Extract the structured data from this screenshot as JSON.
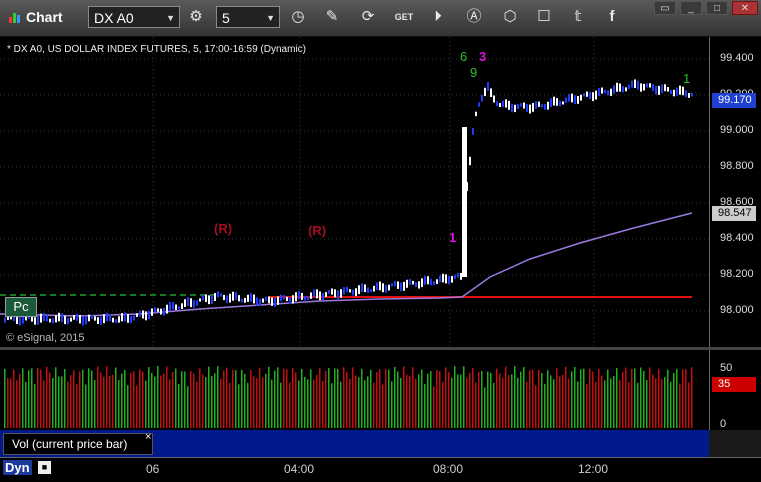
{
  "app": {
    "title": "Chart"
  },
  "toolbar": {
    "symbol": "DX A0",
    "interval": "5",
    "icons": [
      "settings-icon",
      "clock-icon",
      "pencil-icon",
      "refresh-icon",
      "get-icon",
      "play-icon",
      "a-icon",
      "tag-icon",
      "comment-icon",
      "twitter-icon",
      "facebook-icon"
    ]
  },
  "window_buttons": [
    "restore",
    "min",
    "max",
    "close"
  ],
  "chart": {
    "description": "* DX A0, US DOLLAR INDEX FUTURES, 5, 17:00-16:59 (Dynamic)",
    "copyright": "© eSignal, 2015",
    "pc_label": "Pc",
    "price_labels": [
      "99.400",
      "99.200",
      "99.000",
      "98.800",
      "98.600",
      "98.400",
      "98.200",
      "98.000"
    ],
    "last_price": "99.170",
    "ma_value": "98.547",
    "annotations": {
      "r1": "(R)",
      "r2": "(R)",
      "n1": "1",
      "n6": "6",
      "n3": "3",
      "n9": "9",
      "n1b": "1"
    },
    "colors": {
      "price_up": "#ffffff",
      "price_down": "#1f3cff",
      "ma": "#9a7ae0",
      "support": "#e01010",
      "last_price_badge": "#2040d0",
      "ma_badge": "#cccccc"
    }
  },
  "volume": {
    "label": "Vol (current price bar)",
    "close_label": "×",
    "axis_labels": [
      "50",
      "0"
    ],
    "current": "35",
    "current_badge_color": "#cc0000"
  },
  "time_axis": {
    "labels": [
      "06",
      "04:00",
      "08:00",
      "12:00"
    ],
    "mode_label": "Dyn",
    "lock_label": "🔒"
  }
}
